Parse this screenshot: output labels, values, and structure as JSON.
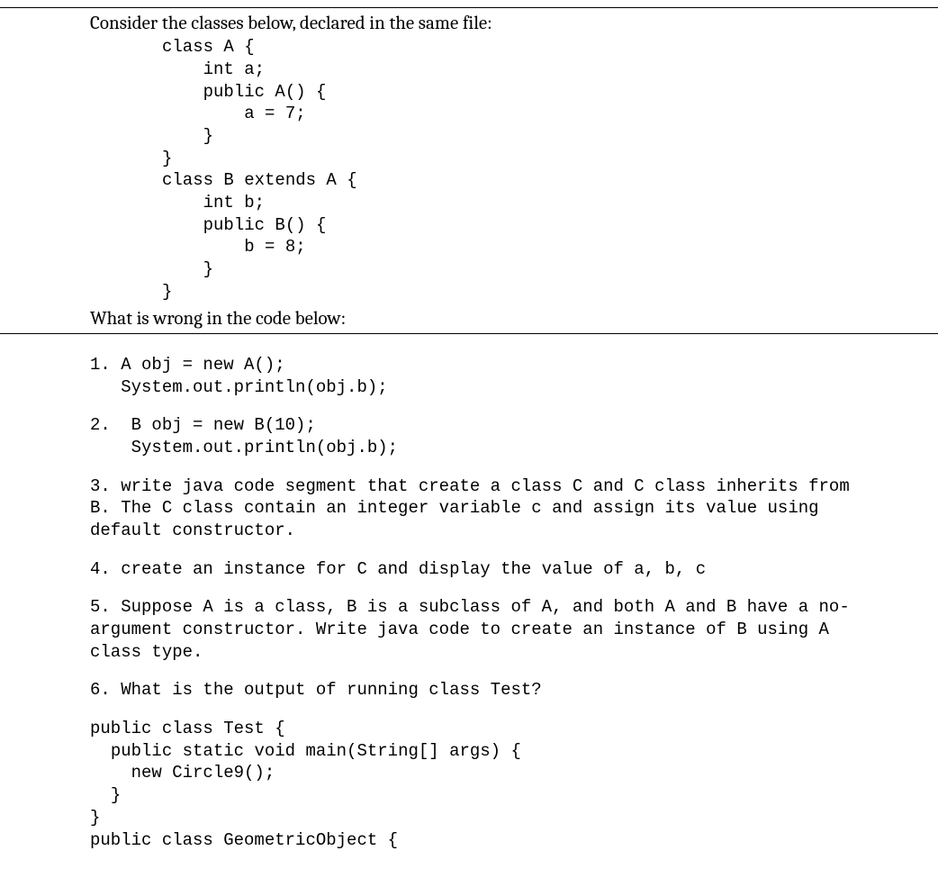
{
  "intro": "Consider the classes below, declared in the same file:",
  "classCode": "class A {\n    int a;\n    public A() {\n        a = 7;\n    }\n}\nclass B extends A {\n    int b;\n    public B() {\n        b = 8;\n    }\n}",
  "prompt": "What is wrong in the code below:",
  "q1": "1. A obj = new A();\n   System.out.println(obj.b);",
  "q2": "2.  B obj = new B(10);\n    System.out.println(obj.b);",
  "q3": "3. write java code segment that create a class C and C class inherits from B. The C class contain an integer variable c and assign its value using default constructor.",
  "q4": "4. create an instance for C and display the value of a, b, c",
  "q5": "5. Suppose A is a class, B is a subclass of A, and both A and B have a no-argument constructor. Write java code to create an instance of B using A class type.",
  "q6": "6. What is the output of running class Test?",
  "q6code": "public class Test {\n  public static void main(String[] args) {\n    new Circle9();\n  }\n}\npublic class GeometricObject {"
}
